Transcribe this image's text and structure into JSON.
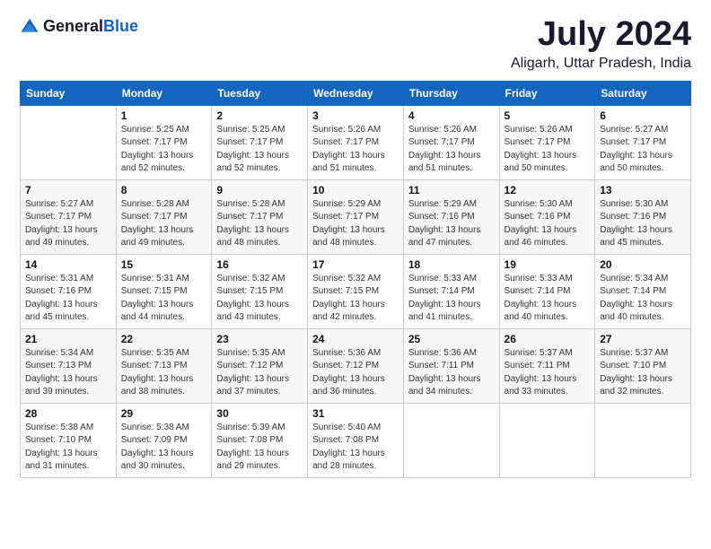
{
  "app": {
    "logo_general": "General",
    "logo_blue": "Blue",
    "month": "July 2024",
    "location": "Aligarh, Uttar Pradesh, India"
  },
  "calendar": {
    "headers": [
      "Sunday",
      "Monday",
      "Tuesday",
      "Wednesday",
      "Thursday",
      "Friday",
      "Saturday"
    ],
    "rows": [
      [
        {
          "day": "",
          "info": ""
        },
        {
          "day": "1",
          "info": "Sunrise: 5:25 AM\nSunset: 7:17 PM\nDaylight: 13 hours\nand 52 minutes."
        },
        {
          "day": "2",
          "info": "Sunrise: 5:25 AM\nSunset: 7:17 PM\nDaylight: 13 hours\nand 52 minutes."
        },
        {
          "day": "3",
          "info": "Sunrise: 5:26 AM\nSunset: 7:17 PM\nDaylight: 13 hours\nand 51 minutes."
        },
        {
          "day": "4",
          "info": "Sunrise: 5:26 AM\nSunset: 7:17 PM\nDaylight: 13 hours\nand 51 minutes."
        },
        {
          "day": "5",
          "info": "Sunrise: 5:26 AM\nSunset: 7:17 PM\nDaylight: 13 hours\nand 50 minutes."
        },
        {
          "day": "6",
          "info": "Sunrise: 5:27 AM\nSunset: 7:17 PM\nDaylight: 13 hours\nand 50 minutes."
        }
      ],
      [
        {
          "day": "7",
          "info": "Sunrise: 5:27 AM\nSunset: 7:17 PM\nDaylight: 13 hours\nand 49 minutes."
        },
        {
          "day": "8",
          "info": "Sunrise: 5:28 AM\nSunset: 7:17 PM\nDaylight: 13 hours\nand 49 minutes."
        },
        {
          "day": "9",
          "info": "Sunrise: 5:28 AM\nSunset: 7:17 PM\nDaylight: 13 hours\nand 48 minutes."
        },
        {
          "day": "10",
          "info": "Sunrise: 5:29 AM\nSunset: 7:17 PM\nDaylight: 13 hours\nand 48 minutes."
        },
        {
          "day": "11",
          "info": "Sunrise: 5:29 AM\nSunset: 7:16 PM\nDaylight: 13 hours\nand 47 minutes."
        },
        {
          "day": "12",
          "info": "Sunrise: 5:30 AM\nSunset: 7:16 PM\nDaylight: 13 hours\nand 46 minutes."
        },
        {
          "day": "13",
          "info": "Sunrise: 5:30 AM\nSunset: 7:16 PM\nDaylight: 13 hours\nand 45 minutes."
        }
      ],
      [
        {
          "day": "14",
          "info": "Sunrise: 5:31 AM\nSunset: 7:16 PM\nDaylight: 13 hours\nand 45 minutes."
        },
        {
          "day": "15",
          "info": "Sunrise: 5:31 AM\nSunset: 7:15 PM\nDaylight: 13 hours\nand 44 minutes."
        },
        {
          "day": "16",
          "info": "Sunrise: 5:32 AM\nSunset: 7:15 PM\nDaylight: 13 hours\nand 43 minutes."
        },
        {
          "day": "17",
          "info": "Sunrise: 5:32 AM\nSunset: 7:15 PM\nDaylight: 13 hours\nand 42 minutes."
        },
        {
          "day": "18",
          "info": "Sunrise: 5:33 AM\nSunset: 7:14 PM\nDaylight: 13 hours\nand 41 minutes."
        },
        {
          "day": "19",
          "info": "Sunrise: 5:33 AM\nSunset: 7:14 PM\nDaylight: 13 hours\nand 40 minutes."
        },
        {
          "day": "20",
          "info": "Sunrise: 5:34 AM\nSunset: 7:14 PM\nDaylight: 13 hours\nand 40 minutes."
        }
      ],
      [
        {
          "day": "21",
          "info": "Sunrise: 5:34 AM\nSunset: 7:13 PM\nDaylight: 13 hours\nand 39 minutes."
        },
        {
          "day": "22",
          "info": "Sunrise: 5:35 AM\nSunset: 7:13 PM\nDaylight: 13 hours\nand 38 minutes."
        },
        {
          "day": "23",
          "info": "Sunrise: 5:35 AM\nSunset: 7:12 PM\nDaylight: 13 hours\nand 37 minutes."
        },
        {
          "day": "24",
          "info": "Sunrise: 5:36 AM\nSunset: 7:12 PM\nDaylight: 13 hours\nand 36 minutes."
        },
        {
          "day": "25",
          "info": "Sunrise: 5:36 AM\nSunset: 7:11 PM\nDaylight: 13 hours\nand 34 minutes."
        },
        {
          "day": "26",
          "info": "Sunrise: 5:37 AM\nSunset: 7:11 PM\nDaylight: 13 hours\nand 33 minutes."
        },
        {
          "day": "27",
          "info": "Sunrise: 5:37 AM\nSunset: 7:10 PM\nDaylight: 13 hours\nand 32 minutes."
        }
      ],
      [
        {
          "day": "28",
          "info": "Sunrise: 5:38 AM\nSunset: 7:10 PM\nDaylight: 13 hours\nand 31 minutes."
        },
        {
          "day": "29",
          "info": "Sunrise: 5:38 AM\nSunset: 7:09 PM\nDaylight: 13 hours\nand 30 minutes."
        },
        {
          "day": "30",
          "info": "Sunrise: 5:39 AM\nSunset: 7:08 PM\nDaylight: 13 hours\nand 29 minutes."
        },
        {
          "day": "31",
          "info": "Sunrise: 5:40 AM\nSunset: 7:08 PM\nDaylight: 13 hours\nand 28 minutes."
        },
        {
          "day": "",
          "info": ""
        },
        {
          "day": "",
          "info": ""
        },
        {
          "day": "",
          "info": ""
        }
      ]
    ]
  }
}
